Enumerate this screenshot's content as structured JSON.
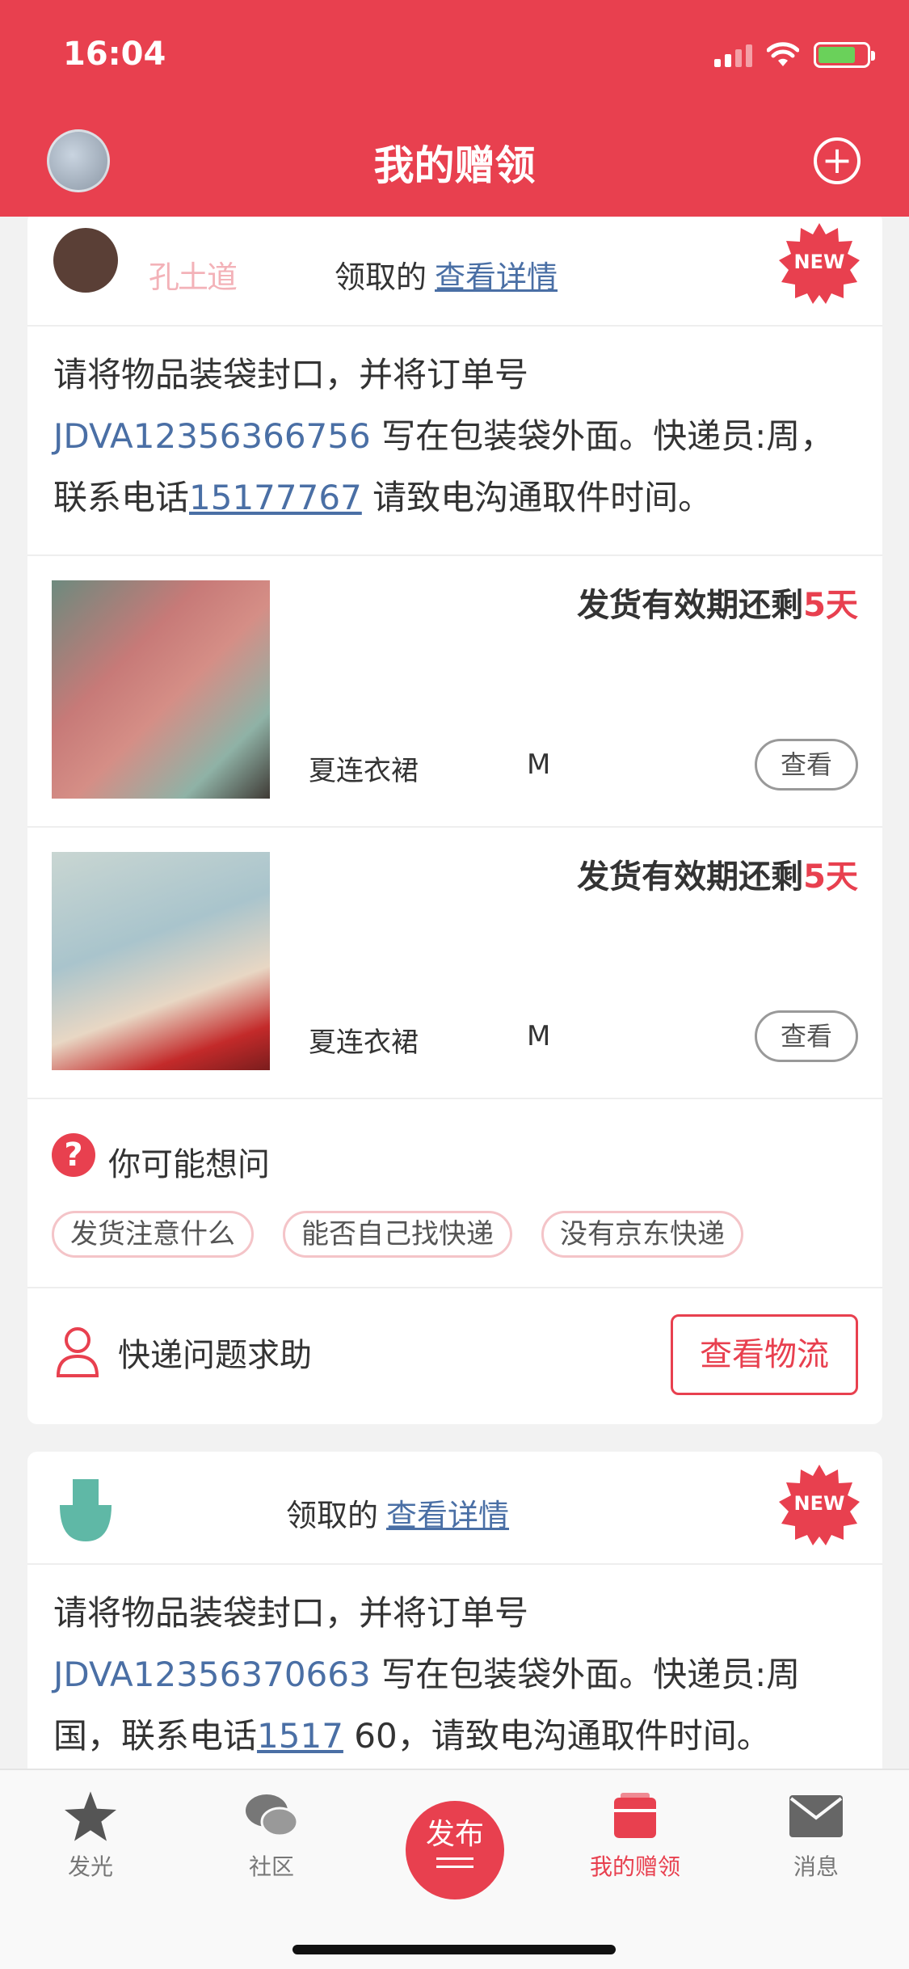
{
  "status_bar": {
    "time": "16:04"
  },
  "header": {
    "title": "我的赠领"
  },
  "cards": [
    {
      "donor_name": "孔土道",
      "claim_text": "领取的",
      "detail_link": "查看详情",
      "badge": "NEW",
      "notice": {
        "part1": "请将物品装袋封口，并将订单号",
        "order": "JDVA12356366756",
        "part2": "写在包装袋外面。快递员:周",
        "part3": "，联系电话",
        "phone": "15177767",
        "part4": "请致电沟通取件时间。"
      },
      "items": [
        {
          "deadline_prefix": "发货有效期还剩",
          "deadline_days": "5天",
          "name": "夏连衣裙",
          "size": "M",
          "view": "查看"
        },
        {
          "deadline_prefix": "发货有效期还剩",
          "deadline_days": "5天",
          "name": "夏连衣裙",
          "size": "M",
          "view": "查看"
        }
      ],
      "faq": {
        "title": "你可能想问",
        "chips": [
          "发货注意什么",
          "能否自己找快递",
          "没有京东快递"
        ]
      },
      "help": {
        "label": "快递问题求助",
        "button": "查看物流"
      }
    },
    {
      "claim_text": "领取的",
      "detail_link": "查看详情",
      "badge": "NEW",
      "notice": {
        "part1": "请将物品装袋封口，并将订单号",
        "order": "JDVA12356370663",
        "part2": "写在包装袋外面。快递员:周国",
        "part3": "，联系电话",
        "phone": "1517",
        "part4": "60，请致电沟通取件时间。"
      }
    }
  ],
  "tabbar": {
    "tabs": [
      {
        "label": "发光",
        "icon": "star-icon"
      },
      {
        "label": "社区",
        "icon": "chat-bubbles-icon"
      },
      {
        "label": "发布",
        "icon": "publish-icon"
      },
      {
        "label": "我的赠领",
        "icon": "gift-box-icon"
      },
      {
        "label": "消息",
        "icon": "envelope-icon"
      }
    ],
    "active_tab": "我的赠领"
  },
  "colors": {
    "brand": "#e8404f",
    "link": "#4a6fa5"
  }
}
